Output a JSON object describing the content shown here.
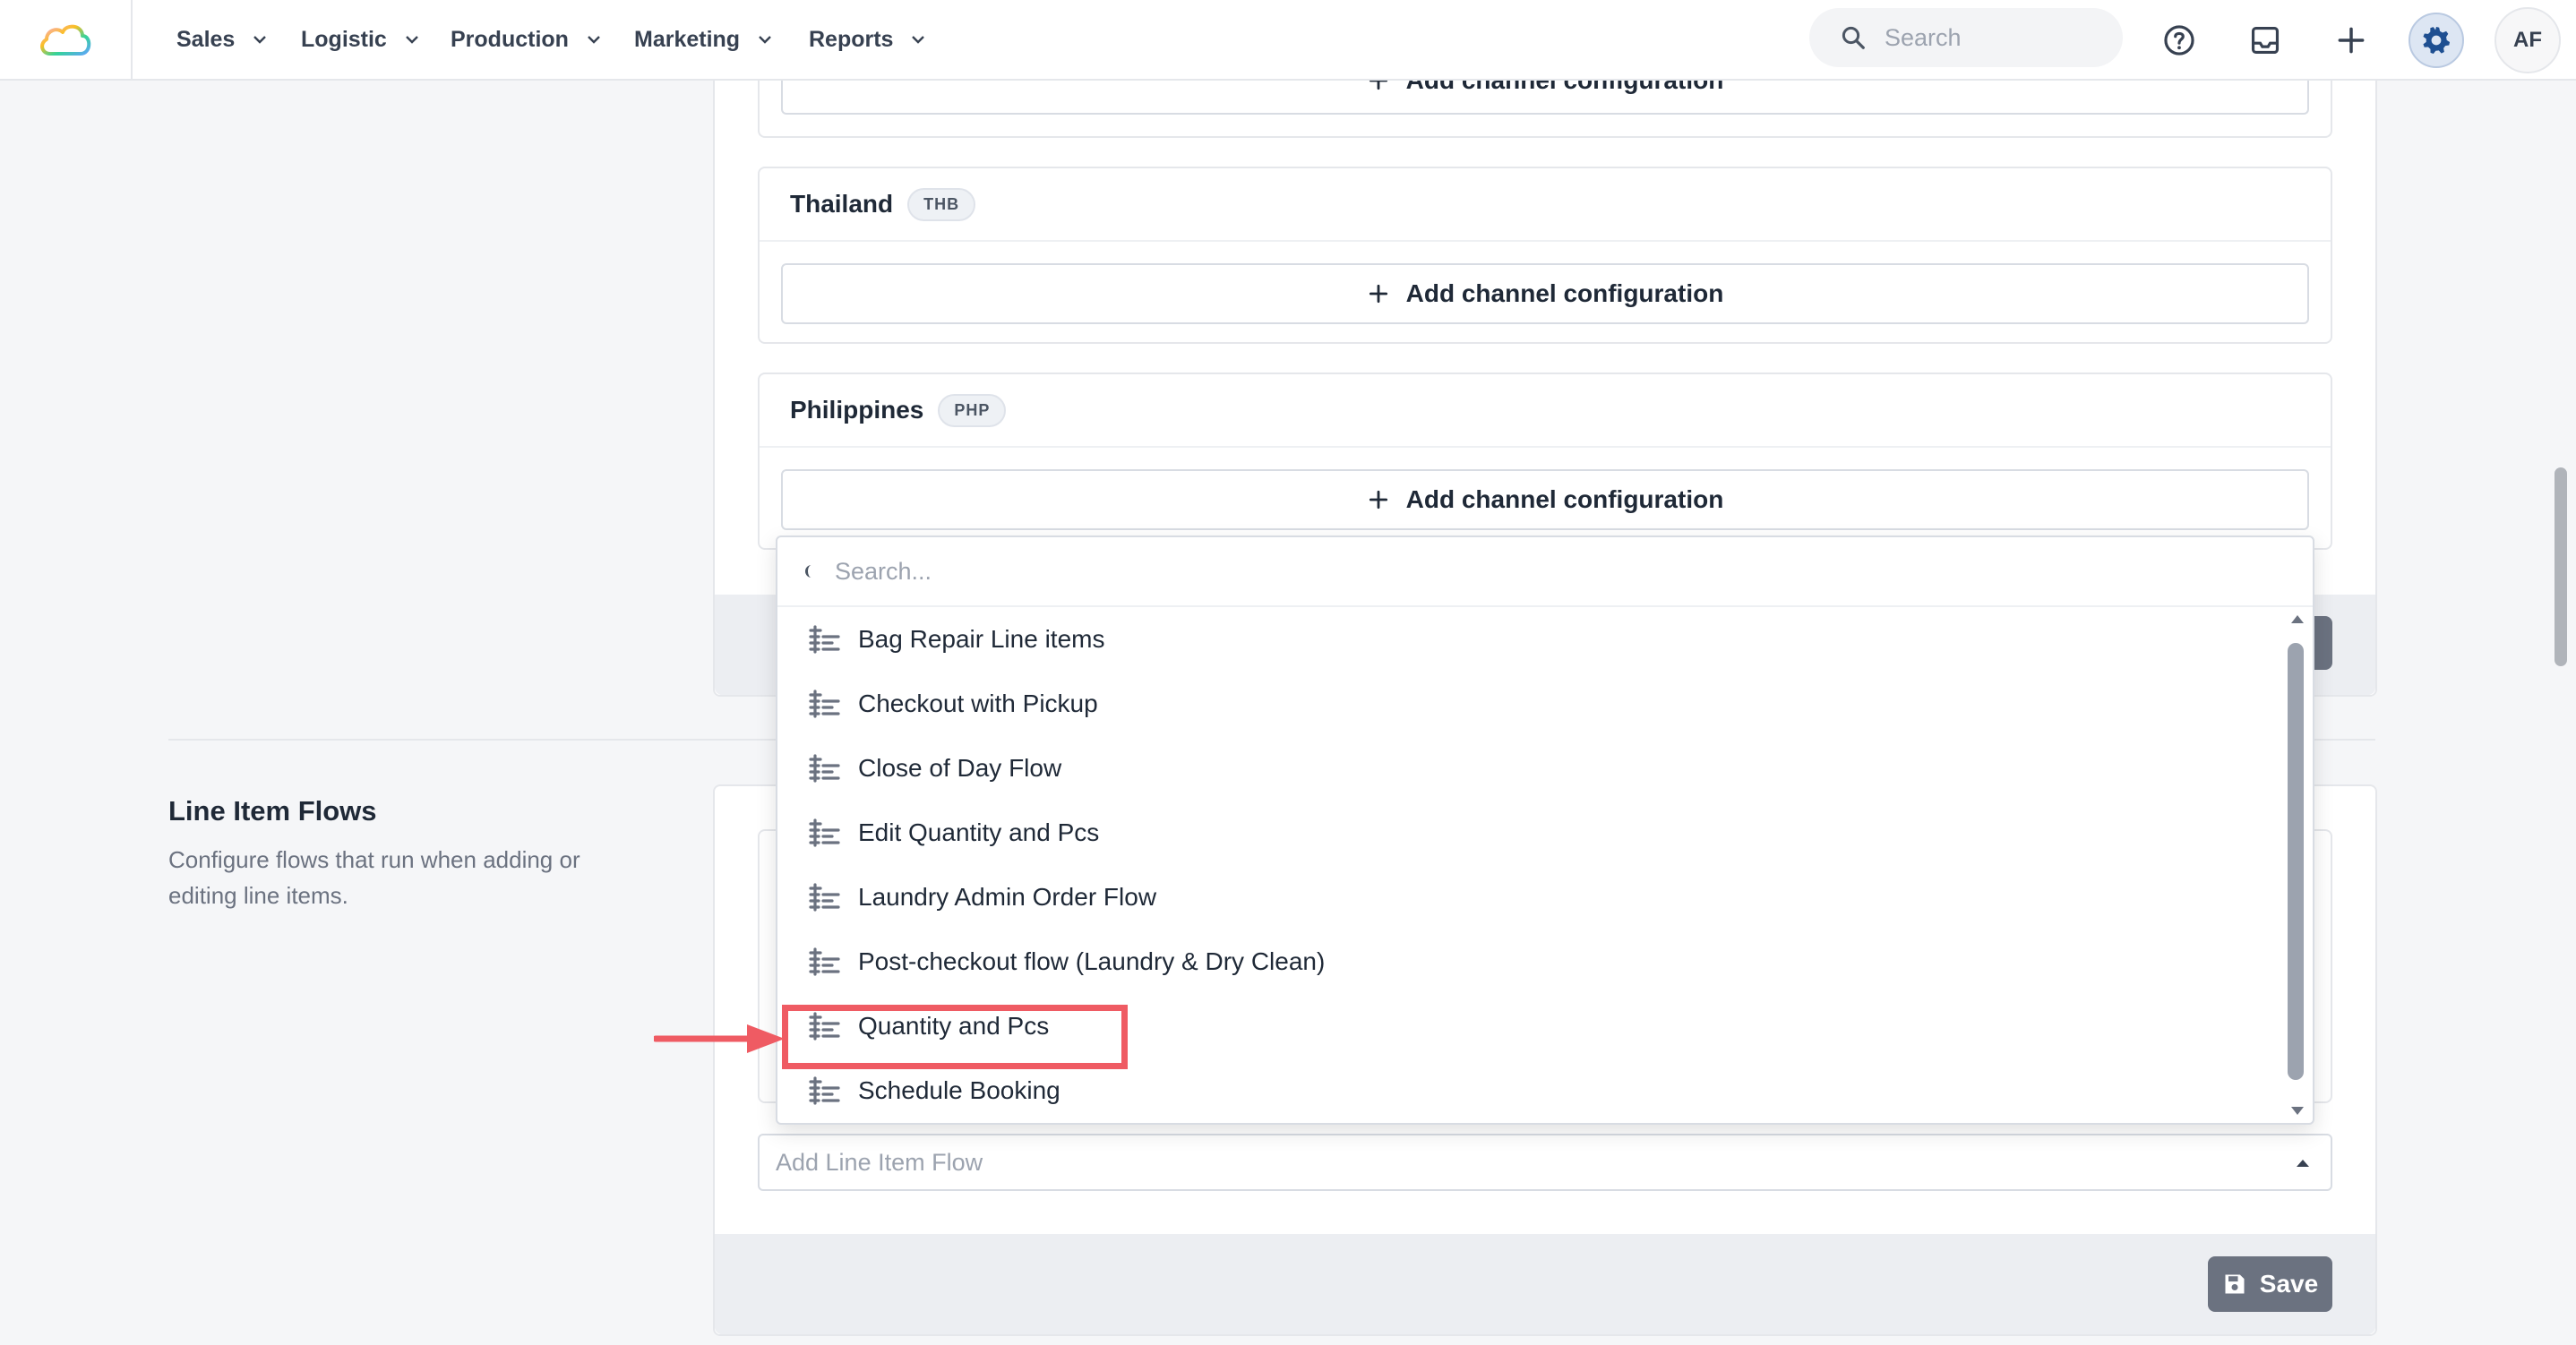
{
  "nav": {
    "items": [
      {
        "label": "Sales"
      },
      {
        "label": "Logistic"
      },
      {
        "label": "Production"
      },
      {
        "label": "Marketing"
      },
      {
        "label": "Reports"
      }
    ],
    "search_placeholder": "Search",
    "avatar_initials": "AF"
  },
  "channels": {
    "add_label": "Add channel configuration",
    "countries": [
      {
        "name": "Thailand",
        "currency": "THB"
      },
      {
        "name": "Philippines",
        "currency": "PHP"
      }
    ]
  },
  "line_item_flows": {
    "title": "Line Item Flows",
    "description": "Configure flows that run when adding or editing line items.",
    "select_placeholder": "Add Line Item Flow",
    "save_label": "Save"
  },
  "dropdown": {
    "search_placeholder": "Search...",
    "options": [
      {
        "label": "Bag Repair Line items"
      },
      {
        "label": "Checkout with Pickup"
      },
      {
        "label": "Close of Day Flow"
      },
      {
        "label": "Edit Quantity and Pcs"
      },
      {
        "label": "Laundry Admin Order Flow"
      },
      {
        "label": "Post-checkout flow (Laundry & Dry Clean)"
      },
      {
        "label": "Quantity and Pcs"
      },
      {
        "label": "Schedule Booking"
      }
    ],
    "highlighted_option": "Quantity and Pcs"
  },
  "colors": {
    "highlight": "#ef5b63",
    "settings_accent": "#1e4f91",
    "save_button": "#6b7280"
  }
}
